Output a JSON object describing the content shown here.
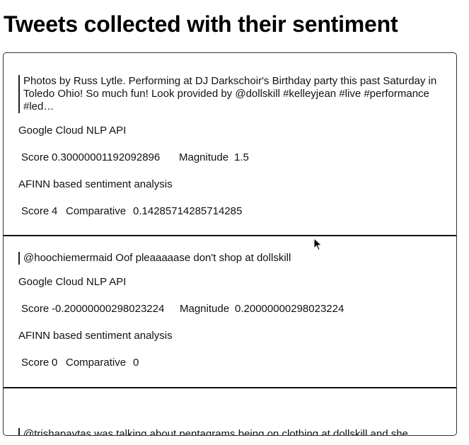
{
  "page": {
    "title": "Tweets collected with their sentiment"
  },
  "tweets": [
    {
      "text": "Photos by Russ Lytle. Performing at DJ Darkschoir's Birthday party this past Saturday in Toledo Ohio! So much fun! Look provided by @dollskill #kelleyjean #live #performance #led…",
      "google_label": "Google Cloud NLP API",
      "google_score_label": "Score",
      "google_score": "0.30000001192092896",
      "google_magnitude_label": "Magnitude",
      "google_magnitude": "1.5",
      "afinn_label": "AFINN based sentiment analysis",
      "afinn_score_label": "Score",
      "afinn_score": "4",
      "afinn_comparative_label": "Comparative",
      "afinn_comparative": "0.14285714285714285"
    },
    {
      "text": "@hoochiemermaid Oof pleaaaaase don't shop at dollskill",
      "google_label": "Google Cloud NLP API",
      "google_score_label": "Score",
      "google_score": "-0.20000000298023224",
      "google_magnitude_label": "Magnitude",
      "google_magnitude": "0.20000000298023224",
      "afinn_label": "AFINN based sentiment analysis",
      "afinn_score_label": "Score",
      "afinn_score": "0",
      "afinn_comparative_label": "Comparative",
      "afinn_comparative": "0"
    },
    {
      "text": "@trishapaytas was talking about pentagrams being on clothing at dollskill and she"
    }
  ]
}
